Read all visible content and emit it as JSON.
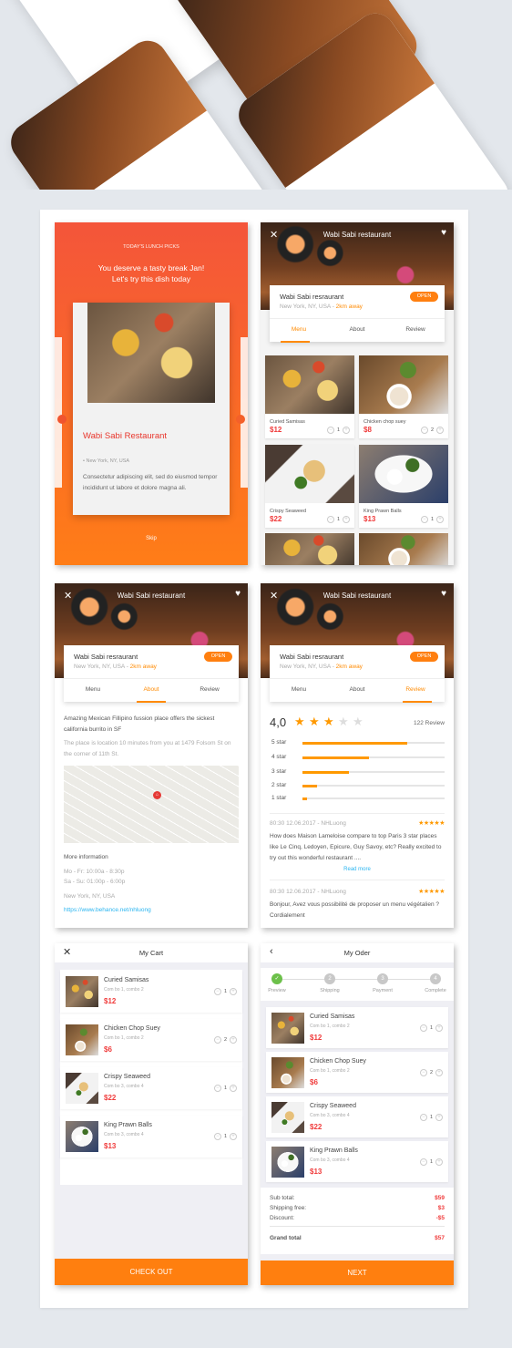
{
  "colors": {
    "accent": "#ff8a00",
    "price": "#f03c3c",
    "gradient_top": "#f4553a",
    "gradient_bottom": "#ff7a1a",
    "link": "#2bb5f0",
    "check": "#6cc04a"
  },
  "onboarding": {
    "eyebrow": "TODAY'S LUNCH PICKS",
    "headline_1": "You deserve a tasty break Jan!",
    "headline_2": "Let's try this dish today",
    "restaurant": "Wabi Sabi Restaurant",
    "location": "New York, NY, USA",
    "description": "Consectetur  adipiscing elit, sed do eiusmod tempor incididunt ut labore et dolore magna ali.",
    "skip": "Skip"
  },
  "restaurant": {
    "header_title": "Wabi Sabi restaurant",
    "name": "Wabi Sabi resraurant",
    "location": "New York, NY, USA - ",
    "distance": "2km away",
    "status": "OPEN",
    "tabs": [
      "Menu",
      "About",
      "Review"
    ]
  },
  "menu": {
    "items": [
      {
        "name": "Curied Samisas",
        "price": "$12",
        "qty": "1"
      },
      {
        "name": "Chicken chop suey",
        "price": "$8",
        "qty": "2"
      },
      {
        "name": "Crispy Seaweed",
        "price": "$22",
        "qty": "1"
      },
      {
        "name": "King Prawn Balls",
        "price": "$13",
        "qty": "1"
      }
    ]
  },
  "about": {
    "intro": "Amazing Mexican Fillipino fussion place offers the sickest california burrito in SF",
    "directions": "The place is location 10 minutes from you at 1479 Folsom St on the corner of 11th St.",
    "more_info": "More information",
    "hours_1": "Mo - Fr: 10:00a - 8:30p",
    "hours_2": "Sa - Su: 01:00p - 6:00p",
    "address": "New York, NY, USA",
    "link": "https://www.behance.net/nhluong"
  },
  "review": {
    "score": "4,0",
    "stars": 3,
    "max_stars": 5,
    "count": "122 Review",
    "distribution": [
      {
        "label": "5 star",
        "fraction": 0.74
      },
      {
        "label": "4 star",
        "fraction": 0.47
      },
      {
        "label": "3 star",
        "fraction": 0.33
      },
      {
        "label": "2 star",
        "fraction": 0.1
      },
      {
        "label": "1 star",
        "fraction": 0.03
      }
    ],
    "reviews": [
      {
        "meta": "80:30 12.06.2017 - NHLuong",
        "stars": "★★★★★",
        "text": "How does Maison Lameloise compare to top Paris 3 star places like Le Cinq, Ledoyen, Epicure, Guy Savoy, etc? Really excited to try out this wonderful restaurant ....",
        "more": "Read more"
      },
      {
        "meta": "80:30 12.06.2017 - NHLuong",
        "stars": "★★★★★",
        "text": "Bonjour, Avez vous possibilité de proposer un menu végétalien ? Cordialement"
      }
    ]
  },
  "cart": {
    "title": "My Cart",
    "checkout": "CHECK OUT",
    "items": [
      {
        "name": "Curied Samisas",
        "combo": "Com bo 1, combo 2",
        "price": "$12",
        "qty": "1"
      },
      {
        "name": "Chicken Chop Suey",
        "combo": "Com bo 1, combo 2",
        "price": "$6",
        "qty": "2"
      },
      {
        "name": "Crispy Seaweed",
        "combo": "Com bo 3, combo 4",
        "price": "$22",
        "qty": "1"
      },
      {
        "name": "King Prawn Balls",
        "combo": "Com bo 3, combo 4",
        "price": "$13",
        "qty": "1"
      }
    ]
  },
  "order": {
    "title": "My Oder",
    "steps": [
      {
        "num": "✓",
        "label": "Preview"
      },
      {
        "num": "2",
        "label": "Shipping"
      },
      {
        "num": "3",
        "label": "Payment"
      },
      {
        "num": "4",
        "label": "Complete"
      }
    ],
    "summary": [
      {
        "label": "Sub total:",
        "value": "$59"
      },
      {
        "label": "Shipping free:",
        "value": "$3"
      },
      {
        "label": "Discount:",
        "value": "-$5"
      }
    ],
    "grand_total_label": "Grand total",
    "grand_total": "$57",
    "next": "NEXT"
  }
}
